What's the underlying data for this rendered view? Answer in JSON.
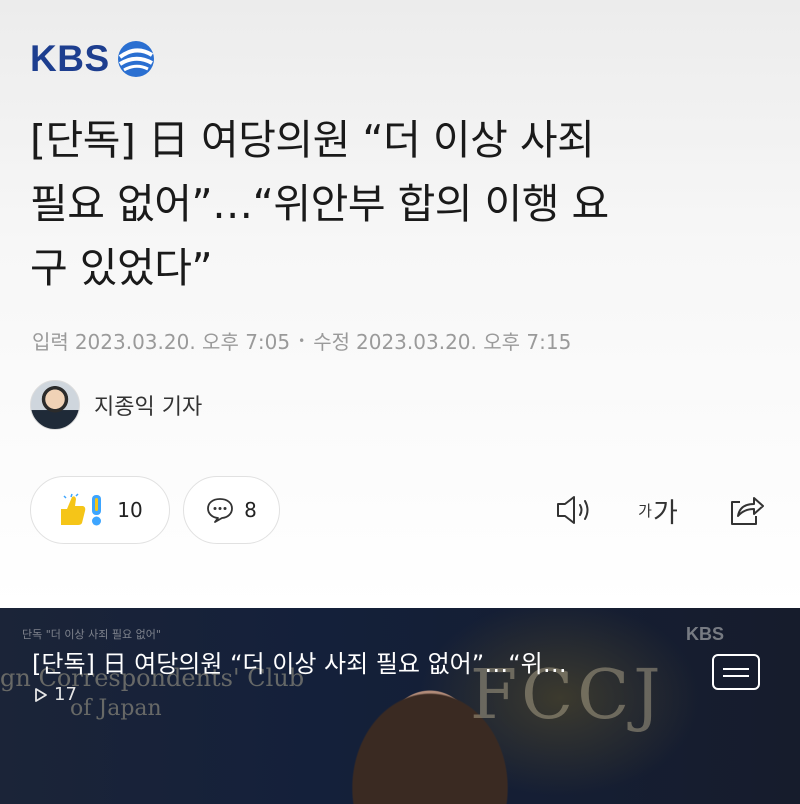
{
  "brand": {
    "name": "KBS"
  },
  "article": {
    "title_line1": "[단독] 日 여당의원 “더 이상 사죄",
    "title_line2": "필요 없어”…“위안부 합의 이행 요",
    "title_line3": "구 있었다”",
    "published_label": "입력",
    "published": "2023.03.20. 오후 7:05",
    "modified_label": "수정",
    "modified": "2023.03.20. 오후 7:15",
    "author": "지종익 기자"
  },
  "reactions": {
    "like_count": "10",
    "comment_count": "8"
  },
  "toolbar": {
    "font_small": "가",
    "font_big": "가"
  },
  "video": {
    "caption_tag": "단독  \"더 이상 사죄 필요 없어\"",
    "title": "[단독] 日 여당의원 “더 이상 사죄 필요 없어”…“위…",
    "views": "17",
    "watermark": "KBS",
    "bg_text_club": "gn Correspondents' Club",
    "bg_text_japan": "of Japan",
    "bg_text_fccj": "FCCJ"
  },
  "colors": {
    "brand_blue": "#1d3e8f",
    "video_bg": "#0f1527",
    "thumb_yellow": "#f5c518"
  },
  "icons": {
    "logo": "kbs-swirl-icon",
    "like": "thumbs-up-emoji-icon",
    "surprise": "exclamation-emoji-icon",
    "comment": "speech-bubble-icon",
    "sound": "speaker-icon",
    "share": "share-icon",
    "play": "play-icon",
    "menu": "list-menu-icon"
  }
}
